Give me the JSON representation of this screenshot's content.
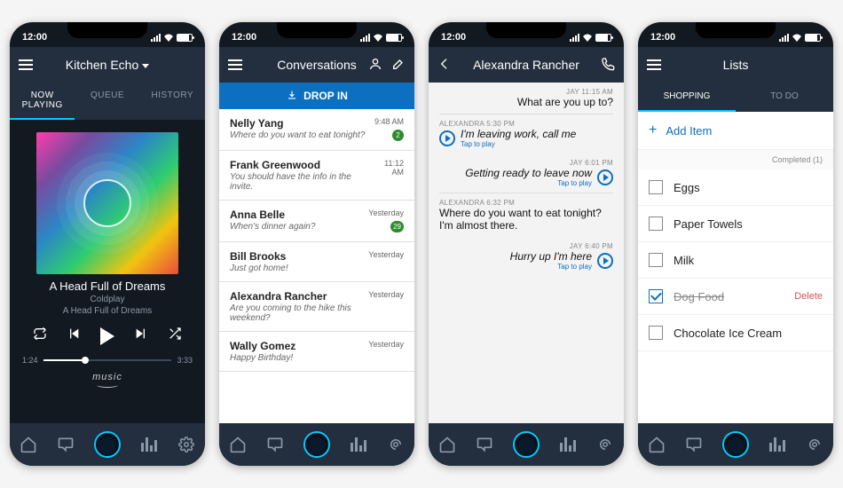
{
  "status": {
    "time": "12:00"
  },
  "phone1": {
    "device": "Kitchen Echo",
    "tabs": [
      "NOW PLAYING",
      "QUEUE",
      "HISTORY"
    ],
    "track_title": "A Head Full of Dreams",
    "track_artist": "Coldplay",
    "track_album": "A Head Full of Dreams",
    "time_elapsed": "1:24",
    "time_total": "3:33",
    "music_brand": "music"
  },
  "phone2": {
    "title": "Conversations",
    "dropin": "DROP IN",
    "items": [
      {
        "name": "Nelly Yang",
        "preview": "Where do you want to eat tonight?",
        "time": "9:48 AM",
        "badge": "2"
      },
      {
        "name": "Frank Greenwood",
        "preview": "You should have the info in the invite.",
        "time": "11:12 AM",
        "badge": ""
      },
      {
        "name": "Anna Belle",
        "preview": "When's dinner again?",
        "time": "Yesterday",
        "badge": "29"
      },
      {
        "name": "Bill Brooks",
        "preview": "Just got home!",
        "time": "Yesterday",
        "badge": ""
      },
      {
        "name": "Alexandra Rancher",
        "preview": "Are you coming to the hike this weekend?",
        "time": "Yesterday",
        "badge": ""
      },
      {
        "name": "Wally Gomez",
        "preview": "Happy Birthday!",
        "time": "Yesterday",
        "badge": ""
      }
    ]
  },
  "phone3": {
    "title": "Alexandra Rancher",
    "tap_label": "Tap to play",
    "msgs": {
      "m1_meta": "JAY   11:15 AM",
      "m1_txt": "What are you up to?",
      "m2_meta": "ALEXANDRA   5:30 PM",
      "m2_txt": "I'm leaving work, call me",
      "m3_meta": "JAY   6:01 PM",
      "m3_txt": "Getting ready to leave now",
      "m4_meta": "ALEXANDRA   6:32 PM",
      "m4_txt1": "Where do you want to eat tonight?",
      "m4_txt2": "I'm almost there.",
      "m5_meta": "JAY   6:40 PM",
      "m5_txt": "Hurry up I'm here"
    }
  },
  "phone4": {
    "title": "Lists",
    "tabs": [
      "SHOPPING",
      "TO DO"
    ],
    "add_label": "Add Item",
    "completed_label": "Completed (1)",
    "items": [
      {
        "label": "Eggs",
        "checked": false
      },
      {
        "label": "Paper Towels",
        "checked": false
      },
      {
        "label": "Milk",
        "checked": false
      },
      {
        "label": "Dog Food",
        "checked": true,
        "delete": "Delete"
      },
      {
        "label": "Chocolate Ice Cream",
        "checked": false
      }
    ]
  }
}
